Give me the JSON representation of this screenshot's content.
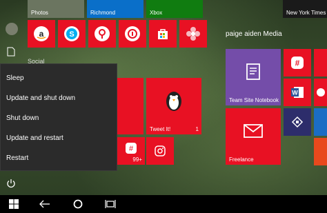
{
  "tiles": {
    "photos": {
      "label": "Photos"
    },
    "richmond": {
      "label": "Richmond"
    },
    "xbox": {
      "label": "Xbox"
    },
    "news": {
      "label": "New York Times"
    },
    "tweetit": {
      "label": "Tweet It!",
      "count": "1"
    },
    "groupme": {
      "badge": "99+"
    },
    "team_site_notebook": {
      "label": "Team Site Notebook"
    },
    "freelance": {
      "label": "Freelance"
    }
  },
  "groups": {
    "paige_media": "paige aiden Media"
  },
  "sidebar": {
    "partial_label": "Social"
  },
  "power_menu": {
    "items": [
      "Sleep",
      "Update and shut down",
      "Shut down",
      "Update and restart",
      "Restart"
    ]
  },
  "colors": {
    "tile_red": "#e81123",
    "tile_green": "#107c10",
    "tile_purple": "#744da9",
    "taskbar": "#000000"
  },
  "icons": [
    "amazon-icon",
    "skype-icon",
    "maps-pin-icon",
    "ticket-icon",
    "store-icon",
    "flower-icon",
    "penguin-icon",
    "groupme-icon",
    "instagram-icon",
    "notebook-icon",
    "mail-icon",
    "slack-icon",
    "word-icon",
    "phone-icon",
    "powerpoint-icon",
    "windows-icon",
    "back-icon",
    "search-icon",
    "task-view-icon",
    "power-icon",
    "document-icon",
    "avatar"
  ]
}
